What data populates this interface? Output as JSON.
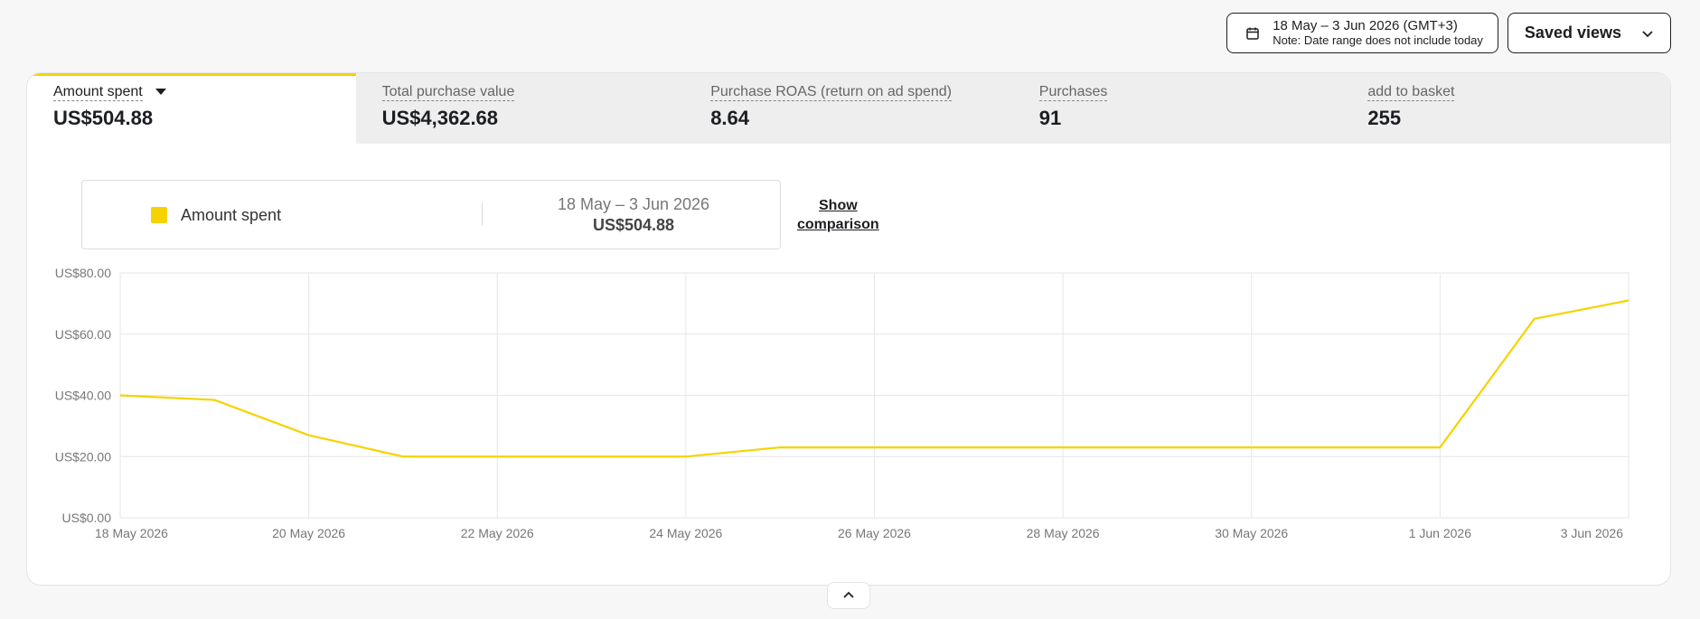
{
  "header": {
    "date_range": "18 May – 3 Jun 2026 (GMT+3)",
    "date_note": "Note: Date range does not include today",
    "saved_views_label": "Saved views"
  },
  "metrics": [
    {
      "label": "Amount spent",
      "value": "US$504.88",
      "active": true
    },
    {
      "label": "Total purchase value",
      "value": "US$4,362.68",
      "active": false
    },
    {
      "label": "Purchase ROAS (return on ad spend)",
      "value": "8.64",
      "active": false
    },
    {
      "label": "Purchases",
      "value": "91",
      "active": false
    },
    {
      "label": "add to basket",
      "value": "255",
      "active": false
    }
  ],
  "legend": {
    "series_name": "Amount spent",
    "range": "18 May – 3 Jun 2026",
    "total": "US$504.88"
  },
  "comparison": {
    "line1": "Show",
    "line2": "comparison"
  },
  "colors": {
    "accent": "#f6d300",
    "active_tab_bg": "#ffffff",
    "inactive_tab_bg": "#eeeeee"
  },
  "icons": {
    "date": "calendar-icon",
    "saved_views": "chevron-down-icon",
    "metric_dropdown": "caret-down-icon",
    "scroll": "chevron-up-icon"
  },
  "chart_data": {
    "type": "line",
    "x": [
      "18 May 2026",
      "19 May 2026",
      "20 May 2026",
      "21 May 2026",
      "22 May 2026",
      "23 May 2026",
      "24 May 2026",
      "25 May 2026",
      "26 May 2026",
      "27 May 2026",
      "28 May 2026",
      "29 May 2026",
      "30 May 2026",
      "31 May 2026",
      "1 Jun 2026",
      "2 Jun 2026",
      "3 Jun 2026"
    ],
    "x_tick_labels": [
      "18 May 2026",
      "20 May 2026",
      "22 May 2026",
      "24 May 2026",
      "26 May 2026",
      "28 May 2026",
      "30 May 2026",
      "1 Jun 2026",
      "3 Jun 2026"
    ],
    "series": [
      {
        "name": "Amount spent",
        "values": [
          40,
          38.5,
          27,
          20,
          20,
          20,
          20,
          23,
          23,
          23,
          23,
          23,
          23,
          23,
          23,
          65,
          71
        ]
      }
    ],
    "y_ticks": [
      "US$0.00",
      "US$20.00",
      "US$40.00",
      "US$60.00",
      "US$80.00"
    ],
    "ylim": [
      0,
      80
    ],
    "grid": true,
    "line_color": "#f6d300"
  }
}
